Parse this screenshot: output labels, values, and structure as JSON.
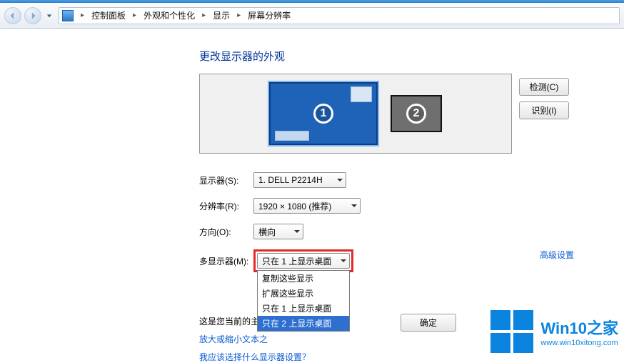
{
  "breadcrumb": {
    "items": [
      "控制面板",
      "外观和个性化",
      "显示",
      "屏幕分辨率"
    ]
  },
  "heading": "更改显示器的外观",
  "side_buttons": {
    "detect": "检测(C)",
    "identify": "识别(I)"
  },
  "monitors": {
    "primary": "1",
    "secondary": "2"
  },
  "form": {
    "display_label": "显示器(S):",
    "display_value": "1. DELL P2214H",
    "resolution_label": "分辨率(R):",
    "resolution_value": "1920 × 1080 (推荐)",
    "orientation_label": "方向(O):",
    "orientation_value": "横向",
    "multi_label": "多显示器(M):",
    "multi_value": "只在 1 上显示桌面",
    "multi_options": [
      "复制这些显示",
      "扩展这些显示",
      "只在 1 上显示桌面",
      "只在 2 上显示桌面"
    ],
    "multi_highlight_index": 3
  },
  "main_text": "这是您当前的主",
  "link_zoom": "放大或缩小文本之",
  "link_which": "我应该选择什么显示器设置？",
  "advanced": "高级设置",
  "footer": {
    "ok": "确定"
  },
  "watermark": {
    "brand": "Win10",
    "brand_suffix": "之家",
    "url": "www.win10xitong.com"
  }
}
